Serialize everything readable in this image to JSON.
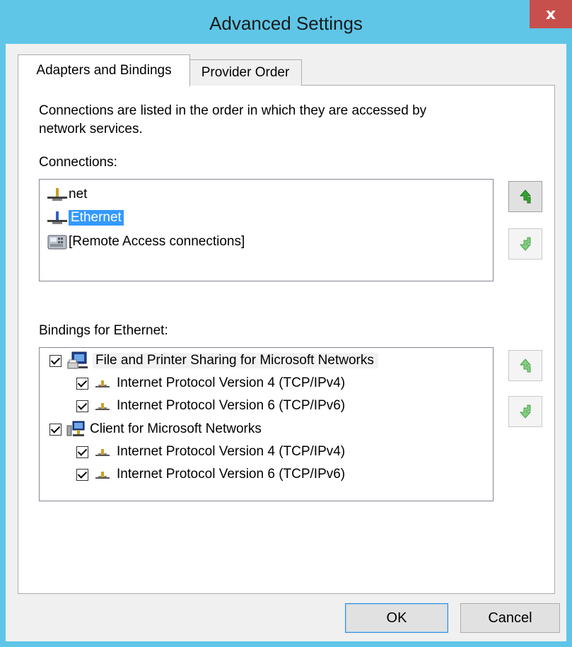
{
  "window": {
    "title": "Advanced Settings",
    "close_glyph": "x"
  },
  "tabs": [
    {
      "label": "Adapters and Bindings",
      "active": true
    },
    {
      "label": "Provider Order",
      "active": false
    }
  ],
  "description": {
    "line1": "Connections are listed in the order in which they are accessed by",
    "line2": "network services."
  },
  "connections": {
    "label": "Connections:",
    "items": [
      {
        "label": "net",
        "icon": "network-adapter-icon",
        "selected": false
      },
      {
        "label": "Ethernet",
        "icon": "network-adapter-icon",
        "selected": true
      },
      {
        "label": "[Remote Access connections]",
        "icon": "phone-icon",
        "selected": false
      }
    ]
  },
  "bindings": {
    "label": "Bindings for Ethernet:",
    "items": [
      {
        "label": "File and Printer Sharing for Microsoft Networks",
        "level": 0,
        "checked": true,
        "icon": "printer-sharing-icon"
      },
      {
        "label": "Internet Protocol Version 4 (TCP/IPv4)",
        "level": 1,
        "checked": true,
        "icon": "protocol-icon"
      },
      {
        "label": "Internet Protocol Version 6 (TCP/IPv6)",
        "level": 1,
        "checked": true,
        "icon": "protocol-icon"
      },
      {
        "label": "Client for Microsoft Networks",
        "level": 0,
        "checked": true,
        "icon": "network-client-icon"
      },
      {
        "label": "Internet Protocol Version 4 (TCP/IPv4)",
        "level": 1,
        "checked": true,
        "icon": "protocol-icon"
      },
      {
        "label": "Internet Protocol Version 6 (TCP/IPv6)",
        "level": 1,
        "checked": true,
        "icon": "protocol-icon"
      }
    ]
  },
  "buttons": {
    "ok": "OK",
    "cancel": "Cancel"
  },
  "colors": {
    "titlebar": "#5fc6e8",
    "close": "#c7504c",
    "selection": "#3399ff",
    "arrow_green": "#3fbf3f"
  }
}
